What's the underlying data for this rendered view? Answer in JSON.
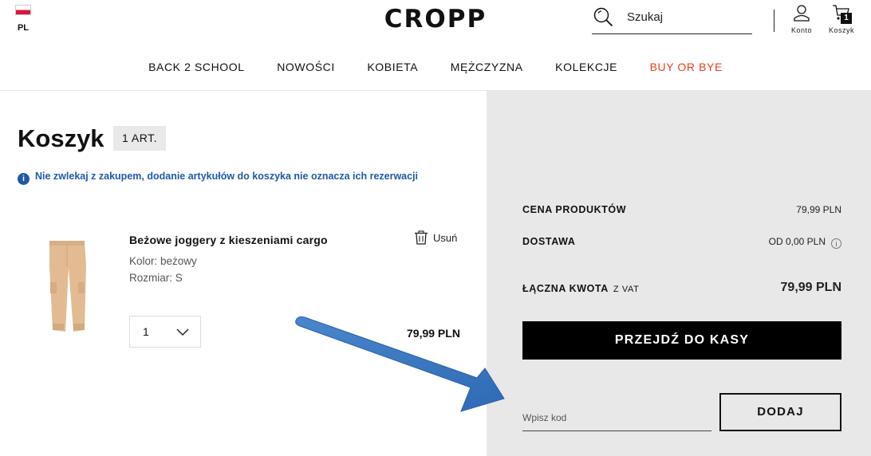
{
  "header": {
    "language": "PL",
    "logo": "CROPP",
    "search_placeholder": "Szukaj",
    "account_label": "Konto",
    "cart_label": "Koszyk",
    "cart_count": "1"
  },
  "nav": {
    "items": [
      "BACK 2 SCHOOL",
      "NOWOŚCI",
      "KOBIETA",
      "MĘŻCZYZNA",
      "KOLEKCJE",
      "BUY OR BYE"
    ],
    "accent_color": "#e8401c"
  },
  "cart": {
    "title": "Koszyk",
    "count_badge": "1 ART.",
    "info_text": "Nie zwlekaj z zakupem, dodanie artykułów do koszyka nie oznacza ich rezerwacji",
    "item": {
      "name": "Beżowe joggery z kieszeniami cargo",
      "color": "Kolor: beżowy",
      "size": "Rozmiar: S",
      "remove_label": "Usuń",
      "quantity": "1",
      "price": "79,99 PLN"
    }
  },
  "summary": {
    "products_label": "CENA PRODUKTÓW",
    "products_value": "79,99 PLN",
    "delivery_label": "DOSTAWA",
    "delivery_value": "OD 0,00 PLN",
    "total_label": "ŁĄCZNA KWOTA",
    "total_vat": "Z VAT",
    "total_value": "79,99 PLN",
    "checkout_label": "PRZEJDŹ DO KASY",
    "promo_placeholder": "Wpisz kod",
    "add_label": "DODAJ"
  },
  "annotation": {
    "arrow_color": "#3a78c2"
  }
}
